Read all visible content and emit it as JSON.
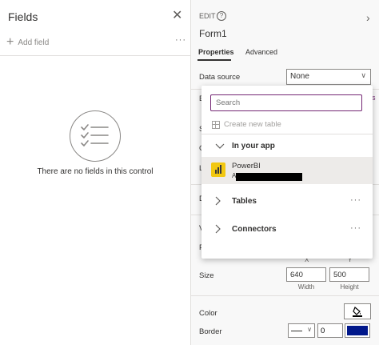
{
  "fields_pane": {
    "title": "Fields",
    "add_field": "Add field",
    "more": "···",
    "empty_message": "There are no fields in this control"
  },
  "props_pane": {
    "edit_label": "EDIT",
    "help": "?",
    "form_name": "Form1",
    "tabs": [
      {
        "label": "Properties",
        "active": true
      },
      {
        "label": "Advanced",
        "active": false
      }
    ],
    "data_source": {
      "label": "Data source",
      "value": "None"
    },
    "size": {
      "label": "Size",
      "width_value": "640",
      "height_value": "500",
      "width_label": "Width",
      "height_label": "Height",
      "x_label": "X",
      "y_label": "Y"
    },
    "color": {
      "label": "Color"
    },
    "border": {
      "label": "Border",
      "width_value": "0",
      "color": "#00178a"
    }
  },
  "dropdown": {
    "search_placeholder": "Search",
    "create_new_table": "Create new table",
    "sections": [
      {
        "label": "In your app",
        "expanded": true
      },
      {
        "label": "Tables",
        "expanded": false,
        "more": "···"
      },
      {
        "label": "Connectors",
        "expanded": false,
        "more": "···"
      }
    ],
    "item": {
      "title": "PowerBI",
      "sub_prefix": "A",
      "icon": "powerbi-icon"
    }
  },
  "colors": {
    "accent": "#742774",
    "pane_bg": "#f8f8f8",
    "powerbi_yellow": "#f2c811",
    "border_color": "#00178a"
  }
}
